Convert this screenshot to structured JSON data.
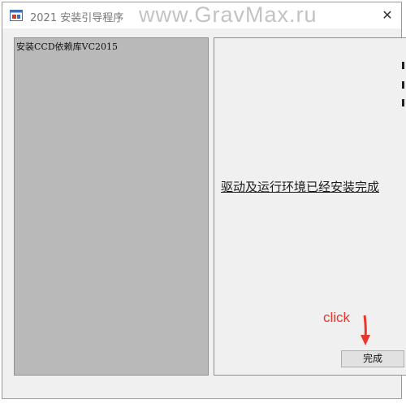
{
  "window": {
    "title": "2021 安装引导程序",
    "watermark": "www.GravMax.ru",
    "close_glyph": "✕"
  },
  "left_panel": {
    "label": "安装CCD依赖库VC2015"
  },
  "right_panel": {
    "status": "驱动及运行环境已经安装完成"
  },
  "footer": {
    "finish_label": "完成"
  },
  "annotation": {
    "text": "click",
    "color": "#e8382b"
  },
  "icons": {
    "app": "app-window-icon",
    "close": "close-icon",
    "arrow": "arrow-down-icon"
  }
}
